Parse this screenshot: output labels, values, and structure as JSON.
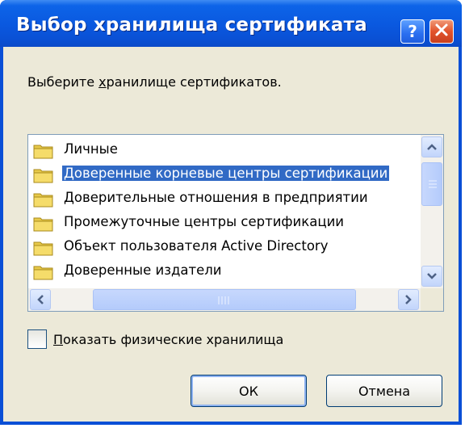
{
  "window": {
    "title": "Выбор хранилища сертификата",
    "help_label": "?",
    "close_label": "✕"
  },
  "prompt": {
    "pre": "Выберите ",
    "underlined": "х",
    "post": "ранилище сертификатов."
  },
  "stores": [
    {
      "label": "Личные",
      "selected": false
    },
    {
      "label": "Доверенные корневые центры сертификации",
      "selected": true
    },
    {
      "label": "Доверительные отношения в предприятии",
      "selected": false
    },
    {
      "label": "Промежуточные центры сертификации",
      "selected": false
    },
    {
      "label": "Объект пользователя Active Directory",
      "selected": false
    },
    {
      "label": "Доверенные издатели",
      "selected": false
    }
  ],
  "scroll": {
    "up_icon": "scroll-up-icon",
    "down_icon": "scroll-down-icon",
    "left_icon": "scroll-left-icon",
    "right_icon": "scroll-right-icon"
  },
  "show_physical": {
    "underlined": "П",
    "rest": "оказать физические хранилища",
    "checked": false
  },
  "buttons": {
    "ok": "ОК",
    "cancel": "Отмена"
  },
  "colors": {
    "titlebar": "#0a58df",
    "selection": "#316ac5",
    "dialog_bg": "#ece9d8",
    "close_button": "#e2532b"
  }
}
